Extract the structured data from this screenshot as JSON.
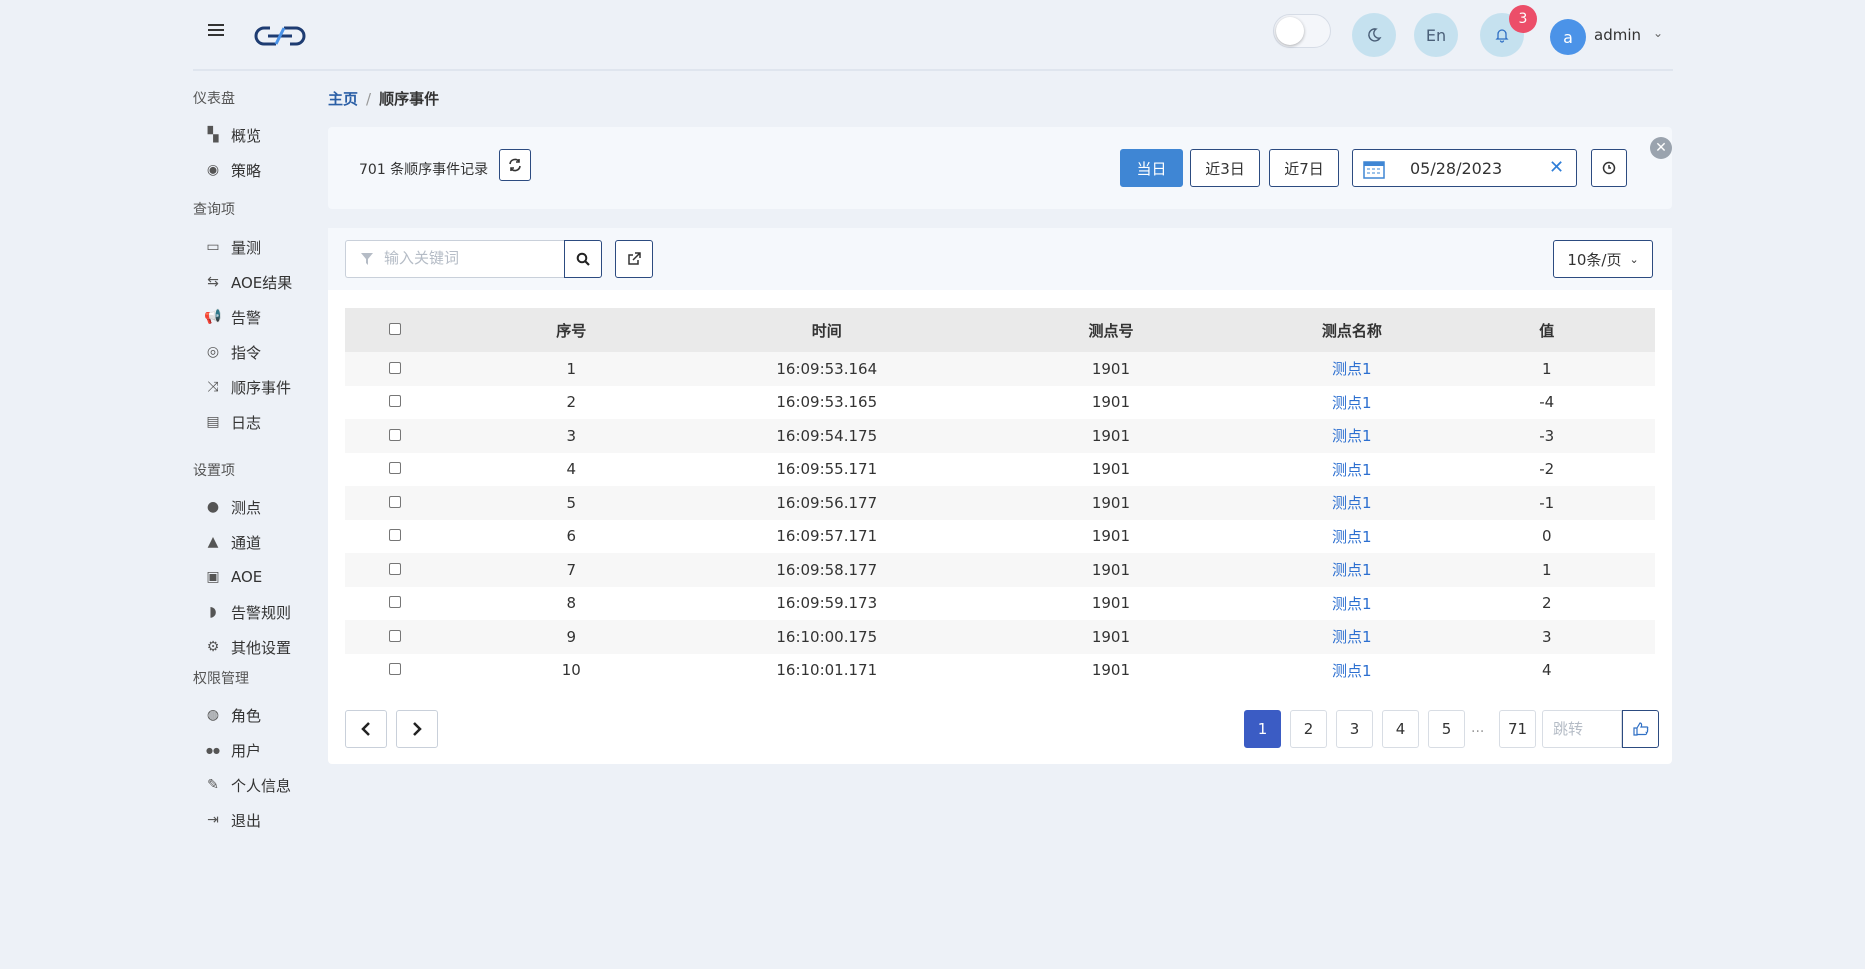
{
  "header": {
    "admin_label": "admin",
    "avatar_letter": "a",
    "lang_label": "En",
    "notification_count": "3"
  },
  "sidebar": {
    "groups": [
      {
        "title": "仪表盘",
        "items": [
          {
            "label": "概览",
            "icon": "dashboard-icon"
          },
          {
            "label": "策略",
            "icon": "compass-icon"
          }
        ]
      },
      {
        "title": "查询项",
        "items": [
          {
            "label": "量测",
            "icon": "monitor-icon"
          },
          {
            "label": "AOE结果",
            "icon": "retweet-icon"
          },
          {
            "label": "告警",
            "icon": "bullhorn-icon"
          },
          {
            "label": "指令",
            "icon": "podcast-icon"
          },
          {
            "label": "顺序事件",
            "icon": "random-icon"
          },
          {
            "label": "日志",
            "icon": "book-icon"
          }
        ]
      },
      {
        "title": "设置项",
        "items": [
          {
            "label": "测点",
            "icon": "pin-icon"
          },
          {
            "label": "通道",
            "icon": "road-icon"
          },
          {
            "label": "AOE",
            "icon": "object-group-icon"
          },
          {
            "label": "告警规则",
            "icon": "shield-icon"
          },
          {
            "label": "其他设置",
            "icon": "gears-icon"
          }
        ]
      },
      {
        "title": "权限管理",
        "items": [
          {
            "label": "角色",
            "icon": "user-circle-icon"
          },
          {
            "label": "用户",
            "icon": "users-icon"
          },
          {
            "label": "个人信息",
            "icon": "edit-icon"
          },
          {
            "label": "退出",
            "icon": "sign-out-icon"
          }
        ]
      }
    ]
  },
  "breadcrumb": {
    "home": "主页",
    "separator": "/",
    "current": "顺序事件"
  },
  "filter": {
    "record_count": "701 条顺序事件记录",
    "today_label": "当日",
    "last3_label": "近3日",
    "last7_label": "近7日",
    "date_value": "05/28/2023"
  },
  "toolbar": {
    "search_placeholder": "输入关键词",
    "per_page_label": "10条/页"
  },
  "table": {
    "headers": [
      "序号",
      "时间",
      "测点号",
      "测点名称",
      "值"
    ],
    "rows": [
      {
        "id": "1",
        "time": "16:09:53.164",
        "point_id": "1901",
        "point_name": "测点1",
        "value": "1"
      },
      {
        "id": "2",
        "time": "16:09:53.165",
        "point_id": "1901",
        "point_name": "测点1",
        "value": "-4"
      },
      {
        "id": "3",
        "time": "16:09:54.175",
        "point_id": "1901",
        "point_name": "测点1",
        "value": "-3"
      },
      {
        "id": "4",
        "time": "16:09:55.171",
        "point_id": "1901",
        "point_name": "测点1",
        "value": "-2"
      },
      {
        "id": "5",
        "time": "16:09:56.177",
        "point_id": "1901",
        "point_name": "测点1",
        "value": "-1"
      },
      {
        "id": "6",
        "time": "16:09:57.171",
        "point_id": "1901",
        "point_name": "测点1",
        "value": "0"
      },
      {
        "id": "7",
        "time": "16:09:58.177",
        "point_id": "1901",
        "point_name": "测点1",
        "value": "1"
      },
      {
        "id": "8",
        "time": "16:09:59.173",
        "point_id": "1901",
        "point_name": "测点1",
        "value": "2"
      },
      {
        "id": "9",
        "time": "16:10:00.175",
        "point_id": "1901",
        "point_name": "测点1",
        "value": "3"
      },
      {
        "id": "10",
        "time": "16:10:01.171",
        "point_id": "1901",
        "point_name": "测点1",
        "value": "4"
      }
    ]
  },
  "pagination": {
    "pages": [
      "1",
      "2",
      "3",
      "4",
      "5"
    ],
    "active_page": "1",
    "ellipsis": "...",
    "last_page": "71",
    "jump_placeholder": "跳转"
  },
  "colors": {
    "primary": "#3f86d4",
    "active_page": "#3b5cc4",
    "link": "#2c6fd0",
    "badge": "#ec4e69",
    "avatar": "#4b93e8"
  }
}
